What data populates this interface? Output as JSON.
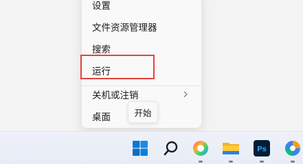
{
  "context_menu": {
    "items": [
      {
        "label": "设置"
      },
      {
        "label": "文件资源管理器"
      },
      {
        "label": "搜索"
      },
      {
        "label": "运行"
      },
      {
        "label": "关机或注销",
        "has_submenu": true
      },
      {
        "label": "桌面"
      }
    ]
  },
  "tooltip": {
    "text": "开始"
  },
  "taskbar": {
    "icons": [
      {
        "name": "start-icon"
      },
      {
        "name": "search-icon"
      },
      {
        "name": "colorful-app-icon"
      },
      {
        "name": "file-explorer-icon"
      },
      {
        "name": "photoshop-icon",
        "text": "Ps"
      },
      {
        "name": "media-app-icon"
      }
    ]
  },
  "colors": {
    "highlight": "#e5413e",
    "windows_blue": "#0a78d4",
    "photoshop_bg": "#001e36",
    "photoshop_text": "#31a8ff"
  }
}
